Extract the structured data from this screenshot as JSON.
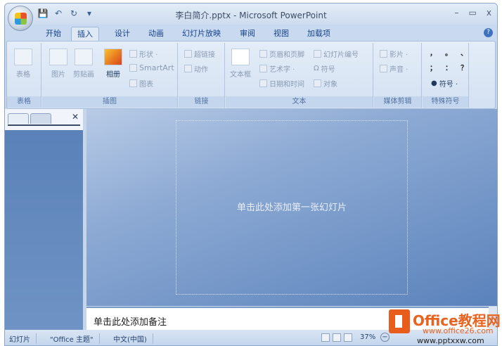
{
  "window": {
    "title": "李白简介.pptx - Microsoft PowerPoint",
    "minimize": "–",
    "maximize": "▭",
    "close": "x"
  },
  "qat": {
    "save": "💾",
    "undo": "↶",
    "redo": "↻",
    "more": "▾"
  },
  "tabs": [
    "开始",
    "插入",
    "设计",
    "动画",
    "幻灯片放映",
    "审阅",
    "视图",
    "加载项"
  ],
  "active_tab": "插入",
  "help": "?",
  "ribbon": {
    "groups": {
      "table": "表格",
      "illustrations": "插图",
      "links": "链接",
      "text": "文本",
      "media": "媒体剪辑",
      "symbols": "特殊符号"
    },
    "table_btn": "表格",
    "picture": "图片",
    "clipart": "剪贴画",
    "album": "相册",
    "shapes": "形状 ·",
    "smartart": "SmartArt",
    "chart": "图表",
    "hyperlink": "超链接",
    "action": "动作",
    "textbox": "文本框",
    "header_footer": "页眉和页脚",
    "wordart": "艺术字 ·",
    "datetime": "日期和时间",
    "slide_number": "幻灯片编号",
    "symbol": "符号",
    "object": "对象",
    "movie": "影片 ·",
    "sound": "声音 ·",
    "special": [
      "，",
      "。",
      "、",
      "；",
      "：",
      "？"
    ],
    "special_more": "符号 ·"
  },
  "left_panel": {
    "close": "✕"
  },
  "slide": {
    "placeholder": "单击此处添加第一张幻灯片"
  },
  "notes": {
    "placeholder": "单击此处添加备注"
  },
  "status": {
    "view": "幻灯片",
    "theme": "\"Office 主题\"",
    "language": "中文(中国)",
    "zoom": "37%",
    "zoom_minus": "−"
  },
  "watermark": {
    "line1": "Office教程网",
    "line2": "www.office26.com",
    "line3": "www.pptxxw.com"
  }
}
